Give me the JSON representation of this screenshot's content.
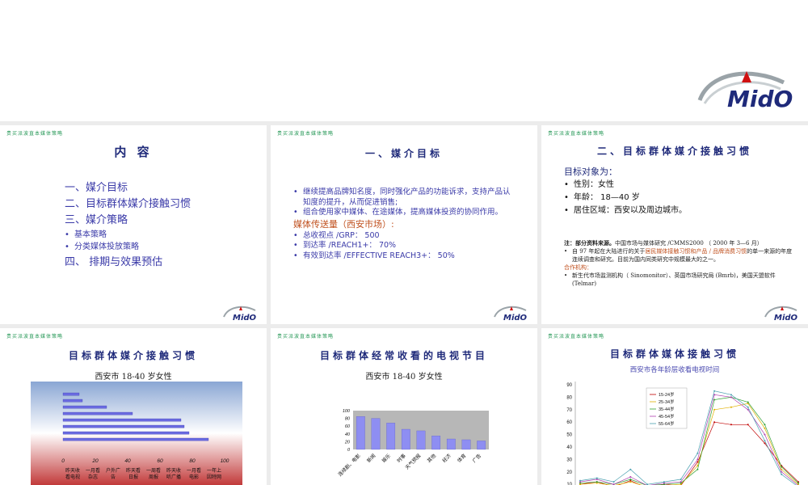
{
  "header_tag": "贵买派波直本媒体策略",
  "logo_text": "MidO",
  "slide1": {
    "title": "内 容",
    "items": [
      "一、媒介目标",
      "二、目标群体媒介接触习惯",
      "三、媒介策略"
    ],
    "subitems": [
      "基本策略",
      "分类媒体投放策略"
    ],
    "last_item": "四、 排期与效果预估"
  },
  "slide2": {
    "title": "一、媒介目标",
    "bullets": [
      "继续提高品牌知名度，同时强化产品的功能诉求，支持产品认知度的提升，从而促进销售;",
      "组合使用家中媒体、在途媒体，提高媒体投资的协同作用。"
    ],
    "section": "媒体传送量（西安市场）:",
    "metrics": [
      "总收视点 /GRP： 500",
      "到达率 /REACH1+： 70%",
      "有效到达率 /EFFECTIVE REACH3+： 50%"
    ]
  },
  "slide3": {
    "title": "二、目标群体媒介接触习惯",
    "target_label": "目标对象为：",
    "target_items": [
      "性别：女性",
      "年龄： 18—40 岁",
      "居住区域：西安以及周边城市。"
    ],
    "note_label": "注：部分资料来源。",
    "note_text": "中国市场与媒体研究 /CMMS2000 （ 2000 年 3—6 月）",
    "note_b1_a": "自 97 年起在大陆进行的关于",
    "note_b1_hl": "居民媒体接触习惯和产品 / 品牌消费习惯",
    "note_b1_c": "的单一来源的年度连续调查和研究。目前为国内同类研究中规模最大的之一。",
    "coop_label": "合作机构：",
    "coop_text": "新生代市场监测机构（ Sinomonitor）、英国市场研究局 (Bmrb)，美国天盟软件 (Telmar)"
  },
  "slide4": {
    "title": "目标群体媒介接触习惯",
    "subtitle": "西安市 18-40 岁女性",
    "chart_data": {
      "type": "bar",
      "orientation": "horizontal",
      "categories": [
        "昨天收看电视",
        "一月看杂志",
        "户外广告",
        "昨天看日报",
        "一周看周报",
        "昨天收听广播",
        "一月看电影",
        "一年上因特网"
      ],
      "values": [
        90,
        78,
        75,
        73,
        43,
        27,
        12,
        10
      ],
      "xlim": [
        0,
        100
      ],
      "xticks": [
        "0",
        "20",
        "40",
        "60",
        "80",
        "100"
      ],
      "labels": [
        "昨天收\n看电视",
        "一月看\n杂志",
        "户外广\n告",
        "昨天看\n日报",
        "一周看\n周报",
        "昨天收\n听广播",
        "一月看\n电影",
        "一年上\n因特网"
      ]
    }
  },
  "slide5": {
    "title": "目标群体经常收看的电视节目",
    "subtitle": "西安市 18-40 岁女性",
    "chart_data": {
      "type": "bar",
      "categories": [
        "连续剧、电影",
        "新闻",
        "娱乐",
        "时事",
        "天气预报",
        "其他",
        "经济",
        "体育",
        "广告"
      ],
      "values": [
        85,
        80,
        68,
        52,
        48,
        35,
        27,
        25,
        22
      ],
      "ylim": [
        0,
        100
      ],
      "yticks": [
        "0",
        "20",
        "40",
        "60",
        "80",
        "100"
      ]
    }
  },
  "slide6": {
    "title": "目标群体媒体接触习惯",
    "subtitle": "西安市各年龄层收看电视时间",
    "chart_data": {
      "type": "line",
      "yticks": [
        "90",
        "80",
        "70",
        "60",
        "50",
        "40",
        "30",
        "20",
        "10"
      ],
      "legend_position": "top-center",
      "series": [
        {
          "name": "15-24岁",
          "color": "#c00000",
          "values": [
            10,
            12,
            8,
            13,
            7,
            10,
            9,
            28,
            60,
            58,
            58,
            43,
            25,
            12
          ]
        },
        {
          "name": "25-34岁",
          "color": "#e0b000",
          "values": [
            10,
            11,
            9,
            12,
            8,
            9,
            10,
            25,
            70,
            72,
            75,
            55,
            22,
            10
          ]
        },
        {
          "name": "35-44岁",
          "color": "#30a030",
          "values": [
            11,
            12,
            10,
            14,
            9,
            10,
            11,
            22,
            78,
            80,
            76,
            58,
            24,
            11
          ]
        },
        {
          "name": "45-54岁",
          "color": "#b040b0",
          "values": [
            12,
            14,
            10,
            16,
            9,
            11,
            12,
            30,
            82,
            80,
            70,
            50,
            20,
            9
          ]
        },
        {
          "name": "55-64岁",
          "color": "#4aa0b0",
          "values": [
            13,
            15,
            12,
            22,
            10,
            12,
            14,
            35,
            85,
            82,
            72,
            45,
            18,
            8
          ]
        }
      ]
    }
  }
}
